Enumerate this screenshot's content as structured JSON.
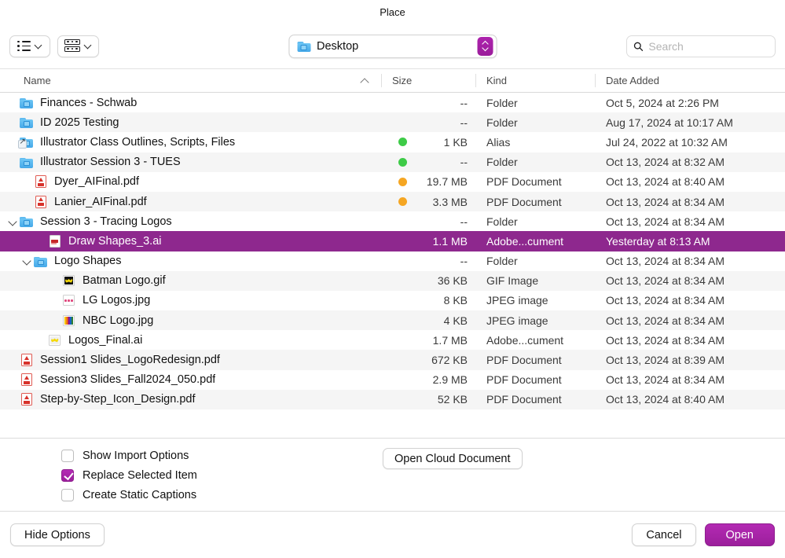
{
  "window": {
    "title": "Place"
  },
  "toolbar": {
    "view_button": {
      "icon": "list-view-icon",
      "chevron": "chevron-down-icon"
    },
    "group_button": {
      "icon": "grid-view-icon",
      "chevron": "chevron-down-icon"
    },
    "path_popup": {
      "label": "Desktop",
      "icon": "desktop-folder-icon",
      "stepper": "up-down-stepper-icon"
    },
    "search": {
      "placeholder": "Search",
      "value": "",
      "icon": "search-icon"
    }
  },
  "columns": [
    {
      "key": "name",
      "label": "Name",
      "sort": "ascending"
    },
    {
      "key": "size",
      "label": "Size"
    },
    {
      "key": "kind",
      "label": "Kind"
    },
    {
      "key": "date",
      "label": "Date Added"
    }
  ],
  "files": [
    {
      "name": "Finances - Schwab",
      "indent": 0,
      "icon": "folder",
      "disclosure": "",
      "tag": "",
      "size": "--",
      "kind": "Folder",
      "date": "Oct 5, 2024 at 2:26 PM",
      "selected": false
    },
    {
      "name": "ID 2025 Testing",
      "indent": 0,
      "icon": "folder",
      "disclosure": "",
      "tag": "",
      "size": "--",
      "kind": "Folder",
      "date": "Aug 17, 2024 at 10:17 AM",
      "selected": false
    },
    {
      "name": "Illustrator Class Outlines, Scripts, Files",
      "indent": 0,
      "icon": "folder-alias",
      "disclosure": "",
      "tag": "green",
      "size": "1 KB",
      "kind": "Alias",
      "date": "Jul 24, 2022 at 10:32 AM",
      "selected": false
    },
    {
      "name": "Illustrator Session 3 - TUES",
      "indent": 0,
      "icon": "folder",
      "disclosure": "",
      "tag": "green",
      "size": "--",
      "kind": "Folder",
      "date": "Oct 13, 2024 at 8:32 AM",
      "selected": false
    },
    {
      "name": "Dyer_AIFinal.pdf",
      "indent": 1,
      "icon": "pdf",
      "disclosure": "",
      "tag": "orange",
      "size": "19.7 MB",
      "kind": "PDF Document",
      "date": "Oct 13, 2024 at 8:40 AM",
      "selected": false
    },
    {
      "name": "Lanier_AIFinal.pdf",
      "indent": 1,
      "icon": "pdf",
      "disclosure": "",
      "tag": "orange",
      "size": "3.3 MB",
      "kind": "PDF Document",
      "date": "Oct 13, 2024 at 8:34 AM",
      "selected": false
    },
    {
      "name": "Session 3 - Tracing Logos",
      "indent": 0,
      "icon": "folder",
      "disclosure": "open",
      "tag": "",
      "size": "--",
      "kind": "Folder",
      "date": "Oct 13, 2024 at 8:34 AM",
      "selected": false
    },
    {
      "name": "Draw Shapes_3.ai",
      "indent": 2,
      "icon": "ai",
      "disclosure": "",
      "tag": "",
      "size": "1.1 MB",
      "kind": "Adobe...cument",
      "date": "Yesterday at 8:13 AM",
      "selected": true
    },
    {
      "name": "Logo Shapes",
      "indent": 1,
      "icon": "folder",
      "disclosure": "open",
      "tag": "",
      "size": "--",
      "kind": "Folder",
      "date": "Oct 13, 2024 at 8:34 AM",
      "selected": false
    },
    {
      "name": "Batman Logo.gif",
      "indent": 3,
      "icon": "thumb-batman",
      "disclosure": "",
      "tag": "",
      "size": "36 KB",
      "kind": "GIF Image",
      "date": "Oct 13, 2024 at 8:34 AM",
      "selected": false
    },
    {
      "name": "LG Logos.jpg",
      "indent": 3,
      "icon": "thumb-lg",
      "disclosure": "",
      "tag": "",
      "size": "8 KB",
      "kind": "JPEG image",
      "date": "Oct 13, 2024 at 8:34 AM",
      "selected": false
    },
    {
      "name": "NBC Logo.jpg",
      "indent": 3,
      "icon": "thumb-nbc",
      "disclosure": "",
      "tag": "",
      "size": "4 KB",
      "kind": "JPEG image",
      "date": "Oct 13, 2024 at 8:34 AM",
      "selected": false
    },
    {
      "name": "Logos_Final.ai",
      "indent": 2,
      "icon": "ai-batman",
      "disclosure": "",
      "tag": "",
      "size": "1.7 MB",
      "kind": "Adobe...cument",
      "date": "Oct 13, 2024 at 8:34 AM",
      "selected": false
    },
    {
      "name": "Session1 Slides_LogoRedesign.pdf",
      "indent": 0,
      "icon": "pdf",
      "disclosure": "",
      "tag": "",
      "size": "672 KB",
      "kind": "PDF Document",
      "date": "Oct 13, 2024 at 8:39 AM",
      "selected": false
    },
    {
      "name": "Session3 Slides_Fall2024_050.pdf",
      "indent": 0,
      "icon": "pdf",
      "disclosure": "",
      "tag": "",
      "size": "2.9 MB",
      "kind": "PDF Document",
      "date": "Oct 13, 2024 at 8:34 AM",
      "selected": false
    },
    {
      "name": "Step-by-Step_Icon_Design.pdf",
      "indent": 0,
      "icon": "pdf",
      "disclosure": "",
      "tag": "",
      "size": "52 KB",
      "kind": "PDF Document",
      "date": "Oct 13, 2024 at 8:40 AM",
      "selected": false
    }
  ],
  "options": {
    "checkboxes": [
      {
        "label": "Show Import Options",
        "checked": false
      },
      {
        "label": "Replace Selected Item",
        "checked": true
      },
      {
        "label": "Create Static Captions",
        "checked": false
      }
    ],
    "cloud_button": "Open Cloud Document"
  },
  "footer": {
    "hide_options": "Hide Options",
    "cancel": "Cancel",
    "open": "Open"
  },
  "colors": {
    "accent": "#9c1f9c",
    "selection": "#8e288e",
    "tag_green": "#3ecb47",
    "tag_orange": "#f5a623"
  }
}
